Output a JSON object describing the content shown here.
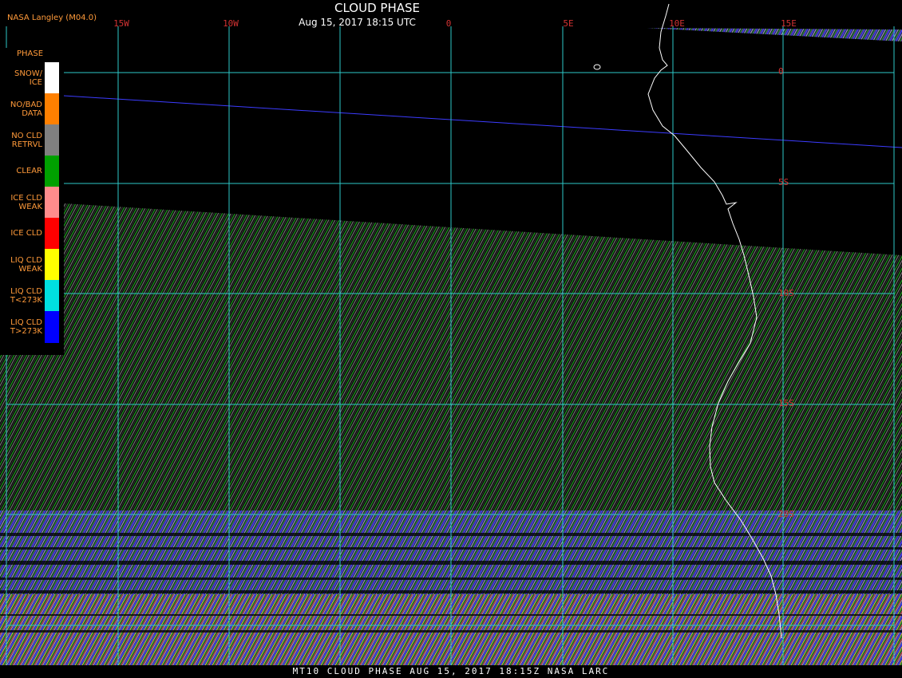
{
  "header": {
    "title": "CLOUD PHASE",
    "datetime": "Aug 15, 2017 18:15 UTC",
    "provider": "NASA Langley (M04.0)"
  },
  "grid": {
    "lon_labels": [
      "15W",
      "10W",
      "0",
      "5E",
      "10E",
      "15E"
    ],
    "lat_labels": [
      "0",
      "5S",
      "10S",
      "15S",
      "20S"
    ]
  },
  "legend": {
    "heading": "PHASE",
    "items": [
      {
        "label": "SNOW/\nICE",
        "color": "#ffffff"
      },
      {
        "label": "NO/BAD\nDATA",
        "color": "#ff8000"
      },
      {
        "label": "NO CLD\nRETRVL",
        "color": "#808080"
      },
      {
        "label": "CLEAR",
        "color": "#00a000"
      },
      {
        "label": "ICE CLD\nWEAK",
        "color": "#ff8c8c"
      },
      {
        "label": "ICE CLD",
        "color": "#ff0000"
      },
      {
        "label": "LIQ CLD\nWEAK",
        "color": "#ffff00"
      },
      {
        "label": "LIQ CLD\nT<273K",
        "color": "#00e0e0"
      },
      {
        "label": "LIQ CLD\nT>273K",
        "color": "#0000ff"
      }
    ]
  },
  "colors": {
    "grid": "#2ec8c8",
    "coast": "#ffffff",
    "labels": "#d23232",
    "legend_text": "#ff9a3a",
    "boundary": "#3c3cff"
  },
  "footer": {
    "text": "MT10  CLOUD PHASE  AUG 15, 2017 18:15Z  NASA LARC"
  }
}
